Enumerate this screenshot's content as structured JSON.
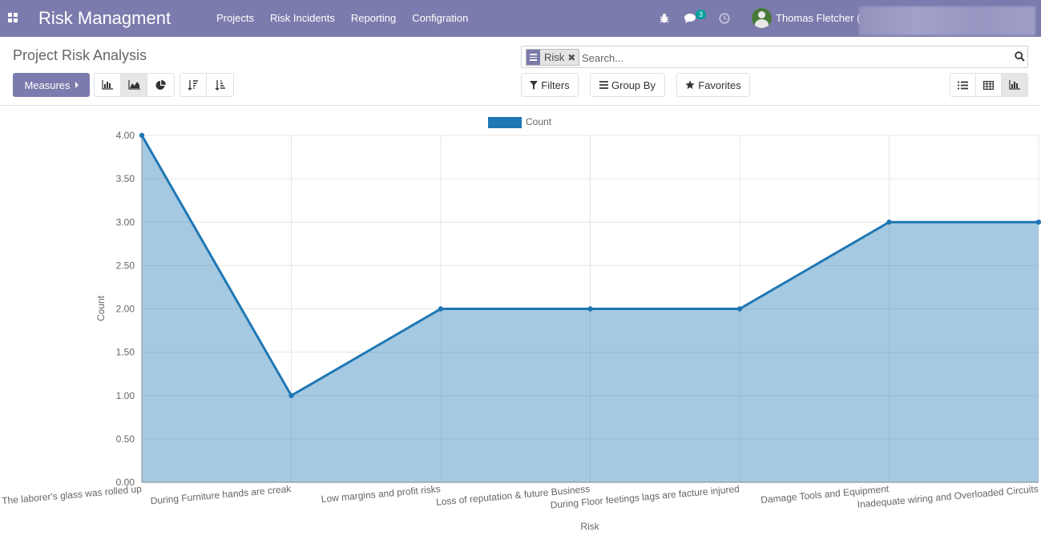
{
  "navbar": {
    "brand": "Risk Managment",
    "menu": [
      "Projects",
      "Risk Incidents",
      "Reporting",
      "Configration"
    ],
    "chat_badge": "3",
    "user_name": "Thomas Fletcher (",
    "accent_color": "#7c7bad"
  },
  "control_panel": {
    "title": "Project Risk Analysis",
    "measures_label": "Measures",
    "search": {
      "facet_value": "Risk",
      "placeholder": "Search..."
    },
    "filters_label": "Filters",
    "group_by_label": "Group By",
    "favorites_label": "Favorites",
    "active_chart_mode": "line",
    "active_view": "graph"
  },
  "chart_data": {
    "type": "line",
    "fill": true,
    "categories": [
      "The laborer's glass was rolled up",
      "During Furniture hands are creak",
      "Low margins and profit risks",
      "Loss of reputation & future Business",
      "During Floor feetings lags are facture injured",
      "Damage Tools and Equipment",
      "Inadequate wiring and Overloaded Circuits"
    ],
    "series": [
      {
        "name": "Count",
        "values": [
          4,
          1,
          2,
          2,
          2,
          3,
          3
        ],
        "color": "#1f77b4"
      }
    ],
    "xlabel": "Risk",
    "ylabel": "Count",
    "ylim": [
      0,
      4
    ],
    "yticks": [
      "0.00",
      "0.50",
      "1.00",
      "1.50",
      "2.00",
      "2.50",
      "3.00",
      "3.50",
      "4.00"
    ],
    "legend_position": "top-center",
    "grid": true
  }
}
